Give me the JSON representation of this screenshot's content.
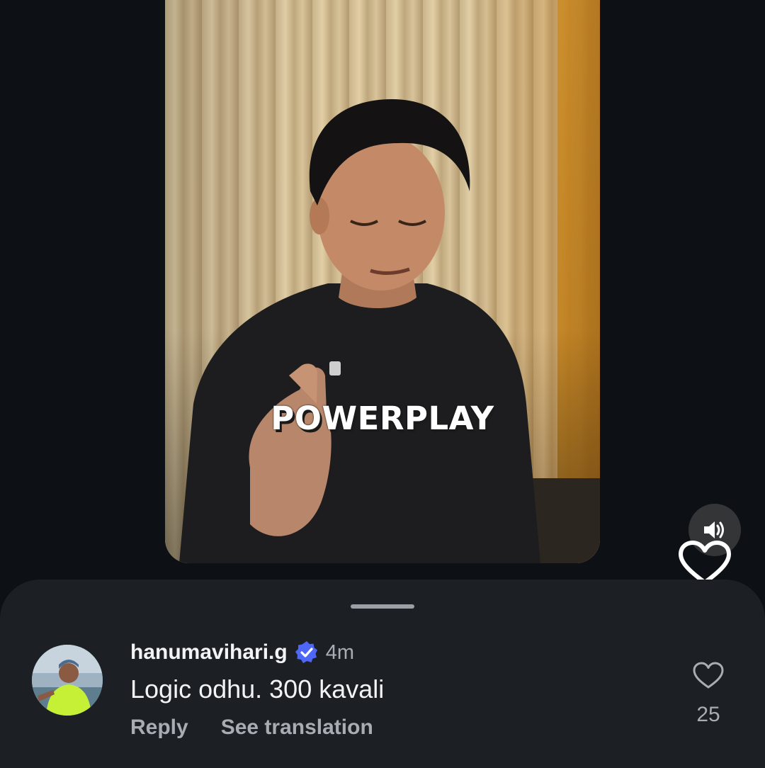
{
  "video": {
    "caption": "POWERPLAY",
    "sound_icon": "speaker-on-icon",
    "heart_icon": "heart-outline-icon"
  },
  "comment": {
    "username": "hanumavihari.g",
    "verified_icon": "verified-badge-icon",
    "timestamp": "4m",
    "text": "Logic odhu. 300 kavali",
    "reply_label": "Reply",
    "translate_label": "See translation",
    "like_icon": "heart-outline-icon",
    "like_count": "25"
  },
  "colors": {
    "background": "#0d1014",
    "sheet": "#1c1f24",
    "verified": "#4f67f5",
    "text_primary": "#f1f3f5",
    "text_secondary": "#a8adb3"
  }
}
